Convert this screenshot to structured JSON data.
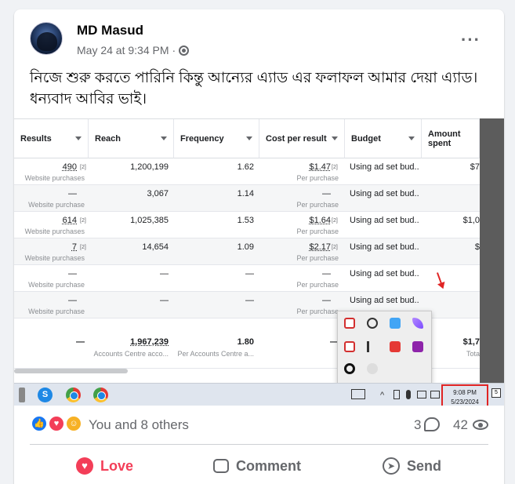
{
  "post": {
    "author": "MD Masud",
    "time": "May 24 at 9:34 PM",
    "separator": "·",
    "more": "···",
    "text": "নিজে শুরু করতে পারিনি কিন্তু আন্যের এ্যাড এর ফলাফল আমার দেয়া এ্যাড। ধন্যবাদ আবির ভাই।"
  },
  "screenshot": {
    "columns": [
      "Results",
      "Reach",
      "Frequency",
      "Cost per result",
      "Budget",
      "Amount spent"
    ],
    "rows": [
      {
        "results": "490",
        "results_sub": "Website purchases",
        "reach": "1,200,199",
        "frequency": "1.62",
        "cost": "$1.47",
        "cost_sub": "Per purchase",
        "budget": "Using ad set bud...",
        "spent": "$7"
      },
      {
        "results": "—",
        "results_sub": "Website purchase",
        "reach": "3,067",
        "frequency": "1.14",
        "cost": "—",
        "cost_sub": "Per purchase",
        "budget": "Using ad set bud...",
        "spent": ""
      },
      {
        "results": "614",
        "results_sub": "Website purchases",
        "reach": "1,025,385",
        "frequency": "1.53",
        "cost": "$1.64",
        "cost_sub": "Per purchase",
        "budget": "Using ad set bud...",
        "spent": "$1,0"
      },
      {
        "results": "7",
        "results_sub": "Website purchases",
        "reach": "14,654",
        "frequency": "1.09",
        "cost": "$2.17",
        "cost_sub": "Per purchase",
        "budget": "Using ad set bud...",
        "spent": "$"
      },
      {
        "results": "—",
        "results_sub": "Website purchase",
        "reach": "—",
        "frequency": "—",
        "cost": "—",
        "cost_sub": "Per purchase",
        "budget": "Using ad set bud...",
        "spent": ""
      },
      {
        "results": "—",
        "results_sub": "Website purchase",
        "reach": "—",
        "frequency": "—",
        "cost": "—",
        "cost_sub": "Per purchase",
        "budget": "Using ad set bud...",
        "spent": ""
      }
    ],
    "sup": "[2]",
    "totals": {
      "results": "—",
      "reach": "1,967,239",
      "reach_sub": "Accounts Centre acco...",
      "frequency": "1.80",
      "frequency_sub": "Per Accounts Centre a...",
      "cost": "—",
      "spent": "$1,7",
      "spent_sub": "Tota"
    },
    "taskbar": {
      "time": "9:08 PM",
      "date": "5/23/2024",
      "notif": "5",
      "skype_letter": "S"
    }
  },
  "stats": {
    "reactions_text": "You and 8 others",
    "comments": "3",
    "views": "42"
  },
  "actions": {
    "love": "Love",
    "comment": "Comment",
    "send": "Send"
  }
}
